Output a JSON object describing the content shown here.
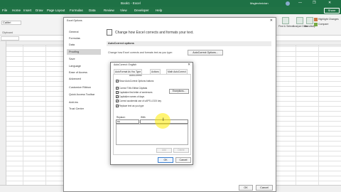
{
  "title_bar": {
    "doc_title": "Book1 - Excel",
    "user": "Msgtechnician",
    "controls": [
      "—",
      "❐",
      "✕"
    ]
  },
  "ribbon_tabs": [
    "File",
    "Home",
    "Insert",
    "Draw",
    "Page Layout",
    "Formulas",
    "Data",
    "Review",
    "View",
    "Developer",
    "Help"
  ],
  "share_label": "Share",
  "ribbon": {
    "font_name": "Calibri",
    "clipboard_label": "Clipboard",
    "groups": [
      {
        "label": "Find &\nSelect"
      },
      {
        "label": "Analyze\nData"
      },
      {
        "label": "Sensitivity"
      }
    ],
    "highlight_changes": "Highlight Changes",
    "compare": "Compare"
  },
  "options_dialog": {
    "title": "Excel Options",
    "nav": [
      "General",
      "Formulas",
      "Data",
      "Proofing",
      "Save",
      "Language",
      "Ease of Access",
      "Advanced",
      "Customize Ribbon",
      "Quick Access Toolbar",
      "Add-ins",
      "Trust Center"
    ],
    "selected_nav_index": 3,
    "heading": "Change how Excel corrects and formats your text.",
    "section_title": "AutoCorrect options",
    "description": "Change how Excel corrects and formats text as you type:",
    "autocorrect_button": "AutoCorrect Options...",
    "ok": "OK",
    "cancel": "Cancel"
  },
  "autocorrect_dialog": {
    "title": "AutoCorrect: English",
    "tabs": [
      "AutoFormat As You Type",
      "Actions",
      "Math AutoCorrect"
    ],
    "selected_tab_label": "AutoCorrect",
    "checkboxes": [
      {
        "label": "Show AutoCorrect Options buttons",
        "checked": true
      },
      {
        "label": "Correct TWo INitial CApitals",
        "checked": true
      },
      {
        "label": "Capitalize first letter of sentences",
        "checked": true
      },
      {
        "label": "Capitalize names of days",
        "checked": true
      },
      {
        "label": "Correct accidental use of cAPS LOCK key",
        "checked": true
      },
      {
        "label": "Replace text as you type",
        "checked": true
      }
    ],
    "exceptions_button": "Exceptions...",
    "replace_label": "Replace:",
    "with_label": "With:",
    "replace_value": "ea",
    "add_button": "Add",
    "delete_button": "Delete",
    "ok": "OK",
    "cancel": "Cancel"
  },
  "colors": {
    "excel_green": "#217346",
    "highlight": "#ffeb00"
  }
}
